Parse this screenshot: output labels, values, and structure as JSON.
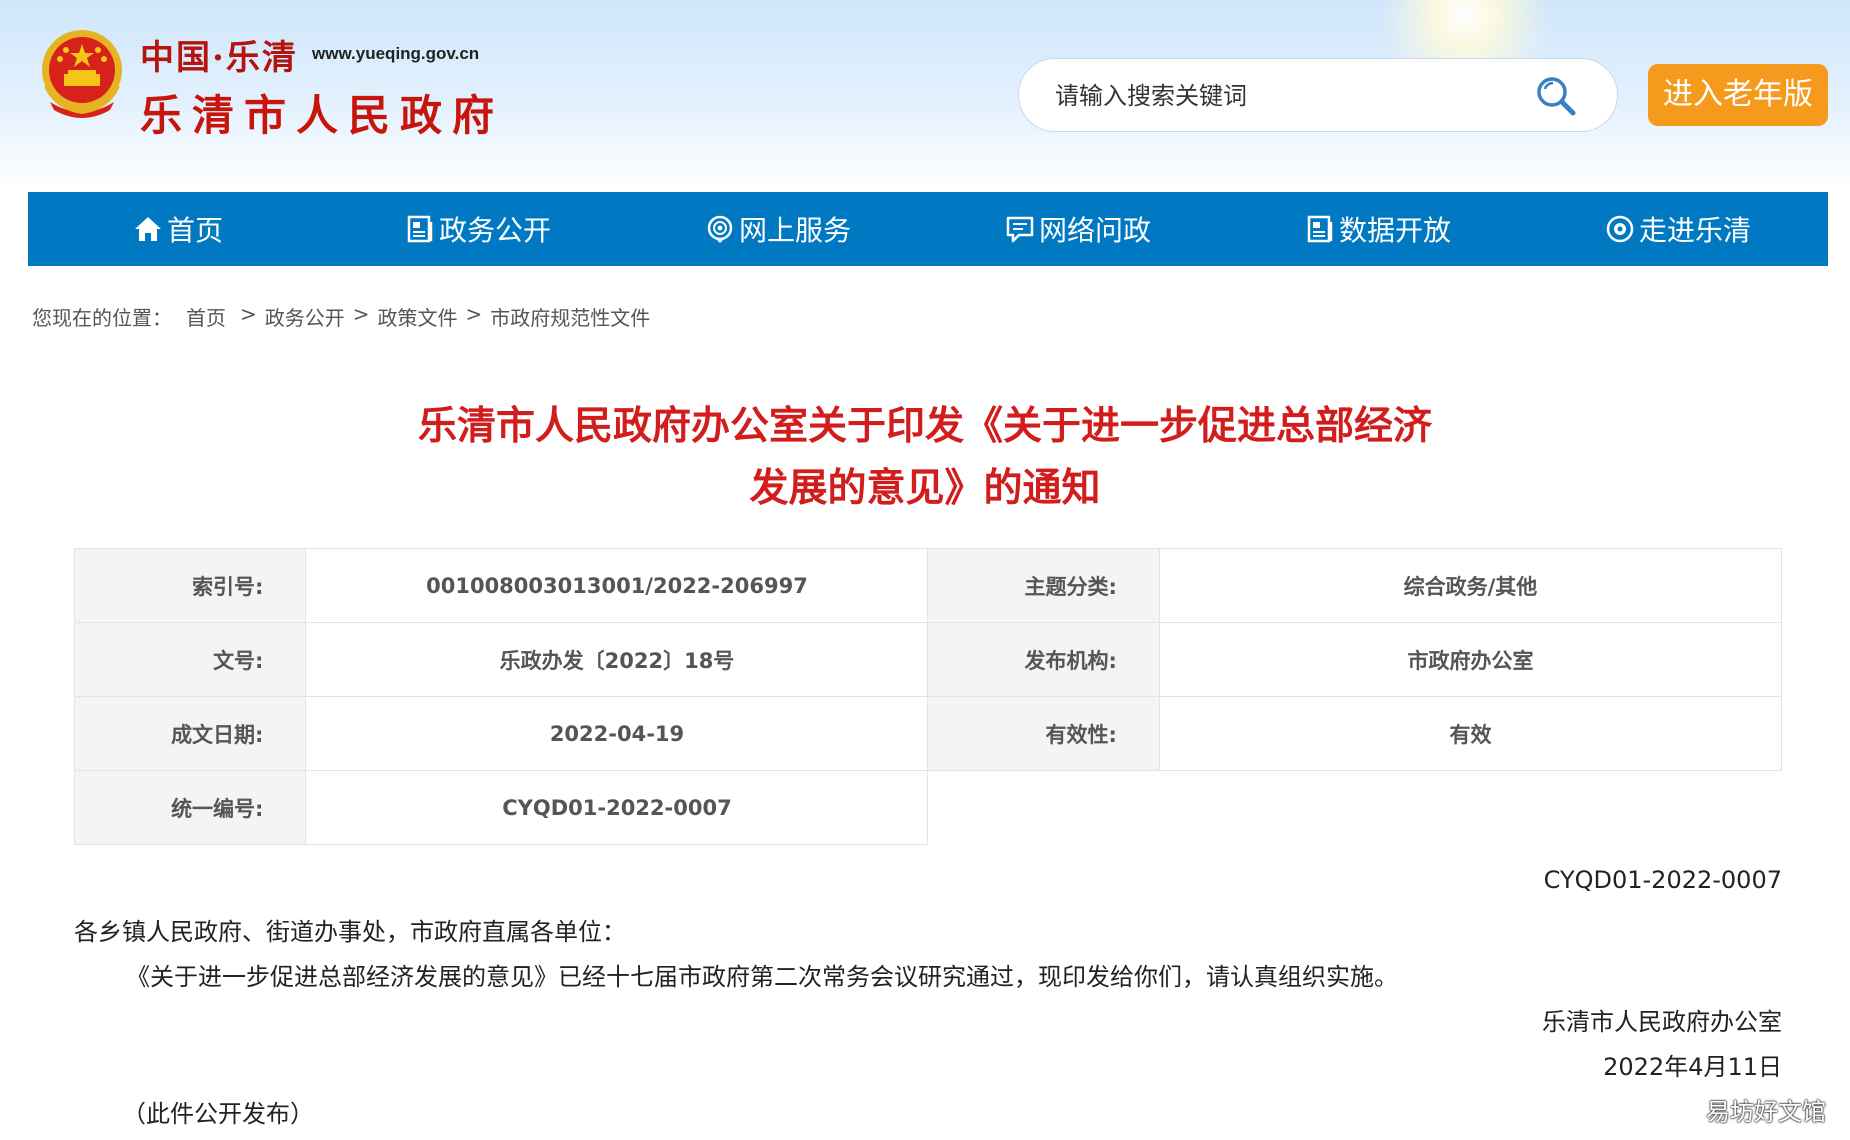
{
  "header": {
    "site_name_small": "中国·乐清",
    "site_url": "www.yueqing.gov.cn",
    "site_name_big": "乐清市人民政府",
    "search_placeholder": "请输入搜索关键词",
    "elder_mode_label": "进入老年版"
  },
  "nav": {
    "items": [
      {
        "label": "首页",
        "icon": "home-icon"
      },
      {
        "label": "政务公开",
        "icon": "document-icon"
      },
      {
        "label": "网上服务",
        "icon": "service-icon"
      },
      {
        "label": "网络问政",
        "icon": "chat-icon"
      },
      {
        "label": "数据开放",
        "icon": "data-icon"
      },
      {
        "label": "走进乐清",
        "icon": "eye-icon"
      }
    ]
  },
  "breadcrumb": {
    "prefix": "您现在的位置：",
    "items": [
      "首页",
      "政务公开",
      "政策文件",
      "市政府规范性文件"
    ],
    "separator": ">"
  },
  "document": {
    "title_line1": "乐清市人民政府办公室关于印发《关于进一步促进总部经济",
    "title_line2": "发展的意见》的通知",
    "info": {
      "index_label": "索引号:",
      "index_value": "001008003013001/2022-206997",
      "topic_label": "主题分类:",
      "topic_value": "综合政务/其他",
      "docno_label": "文号:",
      "docno_value": "乐政办发〔2022〕18号",
      "publisher_label": "发布机构:",
      "publisher_value": "市政府办公室",
      "date_label": "成文日期:",
      "date_value": "2022-04-19",
      "validity_label": "有效性:",
      "validity_value": "有效",
      "unified_label": "统一编号:",
      "unified_value": "CYQD01-2022-0007"
    },
    "doc_number": "CYQD01-2022-0007",
    "salutation": "各乡镇人民政府、街道办事处，市政府直属各单位：",
    "paragraph": "《关于进一步促进总部经济发展的意见》已经十七届市政府第二次常务会议研究通过，现印发给你们，请认真组织实施。",
    "signature_org": "乐清市人民政府办公室",
    "signature_date": "2022年4月11日",
    "note": "（此件公开发布）"
  },
  "watermark": "易坊好文馆",
  "colors": {
    "nav_blue": "#0079c2",
    "title_red": "#d21d1d",
    "elder_orange": "#f59a1d"
  }
}
